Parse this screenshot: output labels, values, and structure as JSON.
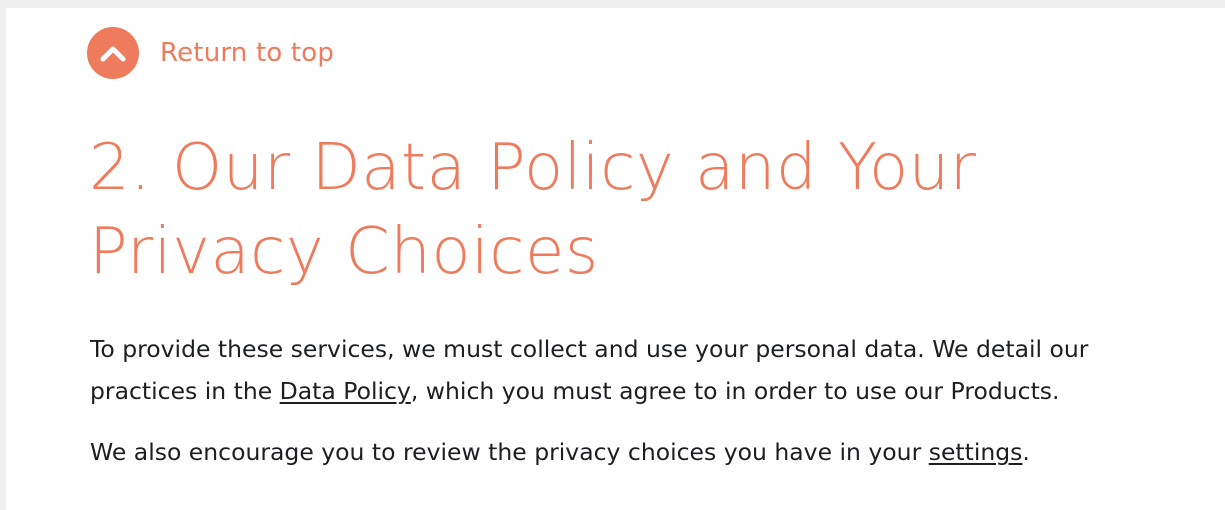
{
  "nav": {
    "return_to_top": "Return to top"
  },
  "section": {
    "title": "2. Our Data Policy and Your Privacy Choices",
    "p1_text_before": "To provide these services, we must collect and use your personal data. We detail our practices in the ",
    "p1_link": "Data Policy",
    "p1_text_after": ", which you must agree to in order to use our Products.",
    "p2_text_before": "We also encourage you to review the privacy choices you have in your ",
    "p2_link": "settings",
    "p2_text_after": "."
  },
  "colors": {
    "accent": "#ee7b5c",
    "text": "#1c1e21",
    "background": "#ffffff"
  },
  "icons": {
    "return_top": "chevron-up-icon"
  }
}
